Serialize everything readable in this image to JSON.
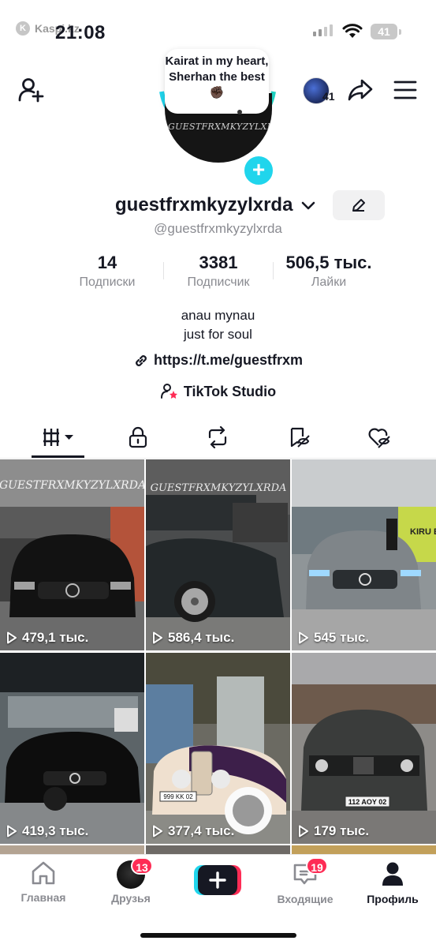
{
  "status_bar": {
    "time": "21:08",
    "carrier": "Kaspi.kz",
    "battery": "41"
  },
  "header": {
    "friends_count": "41",
    "icons": [
      "add-user-icon",
      "share-icon",
      "menu-icon"
    ]
  },
  "profile": {
    "note": "Kairat in my heart, Sherhan the best✊🏿",
    "avatar_text": "GUESTFRXMKYZYLXRDA",
    "username": "guestfrxmkyzylxrda",
    "handle": "@guestfrxmkyzylxrda",
    "stats": [
      {
        "num": "14",
        "label": "Подписки"
      },
      {
        "num": "3381",
        "label": "Подписчик"
      },
      {
        "num": "506,5 тыс.",
        "label": "Лайки"
      }
    ],
    "bio_lines": [
      "anau mynau",
      "just for soul"
    ],
    "link": "https://t.me/guestfrxm",
    "studio": "TikTok Studio"
  },
  "tabs": [
    "videos-tab",
    "private-tab",
    "reposts-tab",
    "favorites-tab",
    "liked-tab"
  ],
  "videos": [
    {
      "views": "479,1 тыс.",
      "overlay": "GUESTFRXMKYZYLXRDA"
    },
    {
      "views": "586,4 тыс.",
      "overlay": "GUESTFRXMKYZYLXRDA"
    },
    {
      "views": "545 тыс.",
      "overlay": "KIRU ВХОД"
    },
    {
      "views": "419,3 тыс.",
      "overlay": ""
    },
    {
      "views": "377,4 тыс.",
      "overlay": "999 KK 02"
    },
    {
      "views": "179 тыс.",
      "overlay": "112 AOY 02"
    }
  ],
  "bottom_nav": [
    {
      "label": "Главная"
    },
    {
      "label": "Друзья",
      "badge": "13"
    },
    {
      "label": ""
    },
    {
      "label": "Входящие",
      "badge": "19"
    },
    {
      "label": "Профиль"
    }
  ],
  "colors": {
    "accent": "#fe2c55",
    "cyan": "#20d5ec",
    "text": "#161823",
    "secondary": "#8a8b91"
  }
}
